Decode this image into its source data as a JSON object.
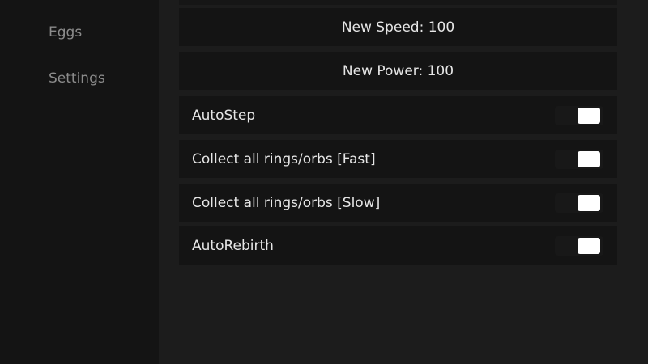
{
  "sidebar": {
    "items": [
      {
        "label": "Eggs"
      },
      {
        "label": "Settings"
      }
    ]
  },
  "main": {
    "speed_button": {
      "label": "New Speed: 100"
    },
    "power_button": {
      "label": "New Power: 100"
    },
    "toggles": [
      {
        "label": "AutoStep",
        "state": "on"
      },
      {
        "label": "Collect all rings/orbs [Fast]",
        "state": "on"
      },
      {
        "label": "Collect all rings/orbs [Slow]",
        "state": "on"
      },
      {
        "label": "AutoRebirth",
        "state": "on"
      }
    ]
  },
  "colors": {
    "sidebar_bg": "#141414",
    "main_bg": "#1c1c1c",
    "row_bg": "#141414",
    "text": "#e6e6e6",
    "sidebar_text": "#8b8b8b",
    "toggle_knob": "#ffffff"
  }
}
